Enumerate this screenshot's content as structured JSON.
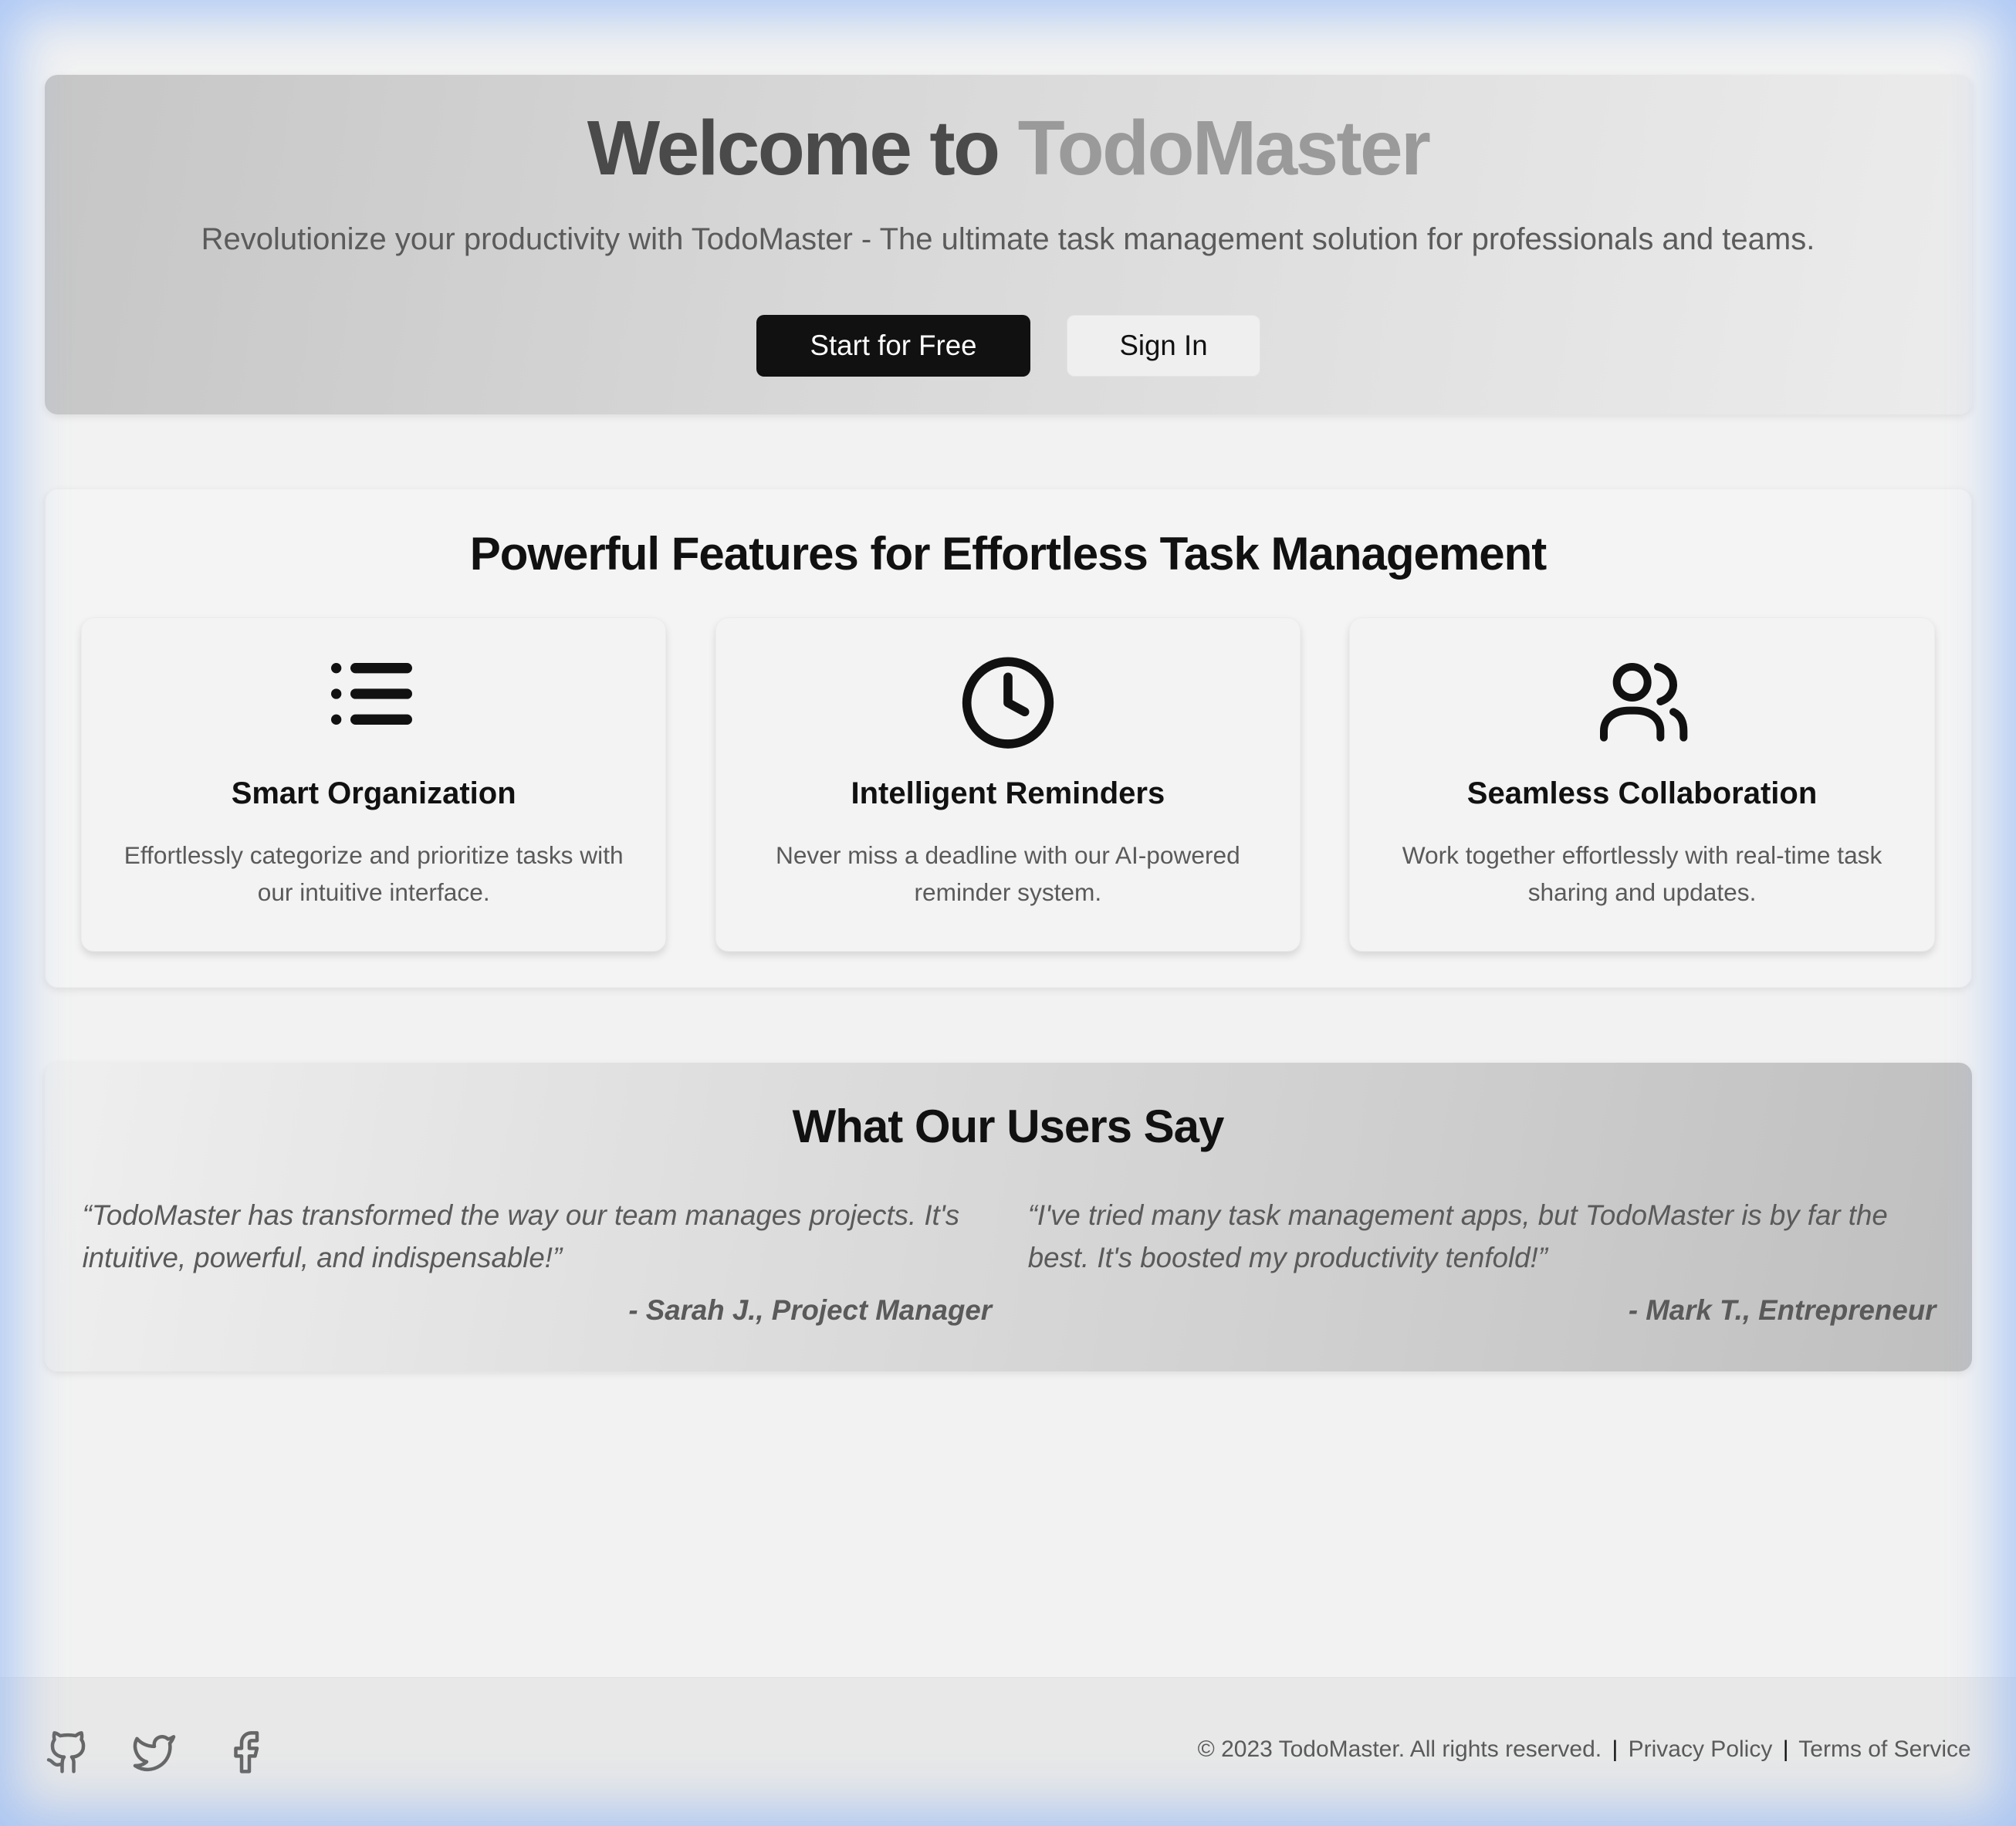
{
  "hero": {
    "title_part1": "Welcome to",
    "title_part2": "TodoMaster",
    "subtitle": "Revolutionize your productivity with TodoMaster - The ultimate task management solution for professionals and teams.",
    "start_label": "Start for Free",
    "signin_label": "Sign In"
  },
  "features": {
    "title": "Powerful Features for Effortless Task Management",
    "cards": [
      {
        "icon": "list-icon",
        "title": "Smart Organization",
        "desc": "Effortlessly categorize and prioritize tasks with our intuitive interface."
      },
      {
        "icon": "clock-icon",
        "title": "Intelligent Reminders",
        "desc": "Never miss a deadline with our AI-powered reminder system."
      },
      {
        "icon": "users-icon",
        "title": "Seamless Collaboration",
        "desc": "Work together effortlessly with real-time task sharing and updates."
      }
    ]
  },
  "testimonials": {
    "title": "What Our Users Say",
    "items": [
      {
        "quote": "“TodoMaster has transformed the way our team manages projects. It's intuitive, powerful, and indispensable!”",
        "author": "- Sarah J., Project Manager"
      },
      {
        "quote": "“I've tried many task management apps, but TodoMaster is by far the best. It's boosted my productivity tenfold!”",
        "author": "- Mark T., Entrepreneur"
      }
    ]
  },
  "footer": {
    "social_icons": [
      "github-icon",
      "twitter-icon",
      "facebook-icon"
    ],
    "copyright": "© 2023 TodoMaster. All rights reserved.",
    "sep": "|",
    "privacy": "Privacy Policy",
    "terms": "Terms of Service"
  },
  "colors": {
    "primary_button_bg": "#111111",
    "secondary_button_bg": "#efefef",
    "page_bg": "#f2f2f2",
    "accent_glow": "#96b9f5"
  }
}
